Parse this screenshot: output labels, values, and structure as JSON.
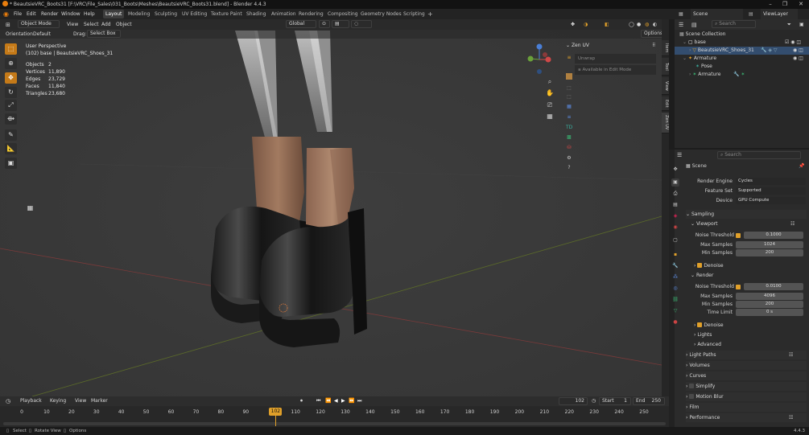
{
  "window": {
    "title": "* BeautsieVRC_Boots31 [F:\\VRC\\File_Sales\\031_Boots\\Meshes\\BeautsieVRC_Boots31.blend] - Blender 4.4.3"
  },
  "menu": [
    "File",
    "Edit",
    "Render",
    "Window",
    "Help"
  ],
  "workspaces": [
    "Layout",
    "Modeling",
    "Sculpting",
    "UV Editing",
    "Texture Paint",
    "Shading",
    "Animation",
    "Rendering",
    "Compositing",
    "Geometry Nodes",
    "Scripting"
  ],
  "header_right": {
    "scene": "Scene",
    "view_layer": "ViewLayer"
  },
  "viewport": {
    "mode": "Object Mode",
    "menus": [
      "View",
      "Select",
      "Add",
      "Object"
    ],
    "transform": "Global",
    "orientation_label": "Orientation:",
    "orientation": "Default",
    "drag_label": "Drag:",
    "drag": "Select Box",
    "options": "Options",
    "perspective": "User Perspective",
    "object_info": "(102) base | BeautsieVRC_Shoes_31",
    "stats": [
      [
        "Objects",
        "2"
      ],
      [
        "Vertices",
        "11,890"
      ],
      [
        "Edges",
        "23,729"
      ],
      [
        "Faces",
        "11,840"
      ],
      [
        "Triangles",
        "23,680"
      ]
    ]
  },
  "zen": {
    "title": "Zen UV",
    "unwrap": "Unwrap",
    "edit_note": "Available in Edit Mode"
  },
  "side_tabs": [
    "Item",
    "Tool",
    "View",
    "Edit",
    "Zen UV"
  ],
  "outliner": {
    "search": "Search",
    "rows": [
      {
        "label": "Scene Collection",
        "indent": 0
      },
      {
        "label": "base",
        "indent": 1
      },
      {
        "label": "BeautsieVRC_Shoes_31",
        "indent": 2
      },
      {
        "label": "Armature",
        "indent": 1
      },
      {
        "label": "Pose",
        "indent": 3
      },
      {
        "label": "Armature",
        "indent": 2
      }
    ]
  },
  "properties": {
    "search": "Search",
    "scene": "Scene",
    "render_engine_label": "Render Engine",
    "render_engine": "Cycles",
    "feature_set_label": "Feature Set",
    "feature_set": "Supported",
    "device_label": "Device",
    "device": "GPU Compute",
    "sampling": "Sampling",
    "viewport": "Viewport",
    "noise_threshold_label": "Noise Threshold",
    "vp_noise": "0.1000",
    "max_samples_label": "Max Samples",
    "vp_max": "1024",
    "min_samples_label": "Min Samples",
    "vp_min": "200",
    "denoise": "Denoise",
    "render": "Render",
    "r_noise": "0.0100",
    "r_max": "4096",
    "r_min": "200",
    "time_limit_label": "Time Limit",
    "r_time": "0 s",
    "lights": "Lights",
    "advanced": "Advanced",
    "sections": [
      "Light Paths",
      "Volumes",
      "Curves",
      "Simplify",
      "Motion Blur",
      "Film",
      "Performance"
    ]
  },
  "timeline": {
    "menus": [
      "Playback",
      "Keying",
      "View",
      "Marker"
    ],
    "current_frame": "102",
    "start_label": "Start",
    "start": "1",
    "end_label": "End",
    "end": "250",
    "ticks": [
      "0",
      "10",
      "20",
      "30",
      "40",
      "50",
      "60",
      "70",
      "80",
      "90",
      "102",
      "110",
      "120",
      "130",
      "140",
      "150",
      "160",
      "170",
      "180",
      "190",
      "200",
      "210",
      "220",
      "230",
      "240",
      "250"
    ]
  },
  "status": {
    "select": "Select",
    "rotate": "Rotate View",
    "options": "Options",
    "version": "4.4.3"
  }
}
